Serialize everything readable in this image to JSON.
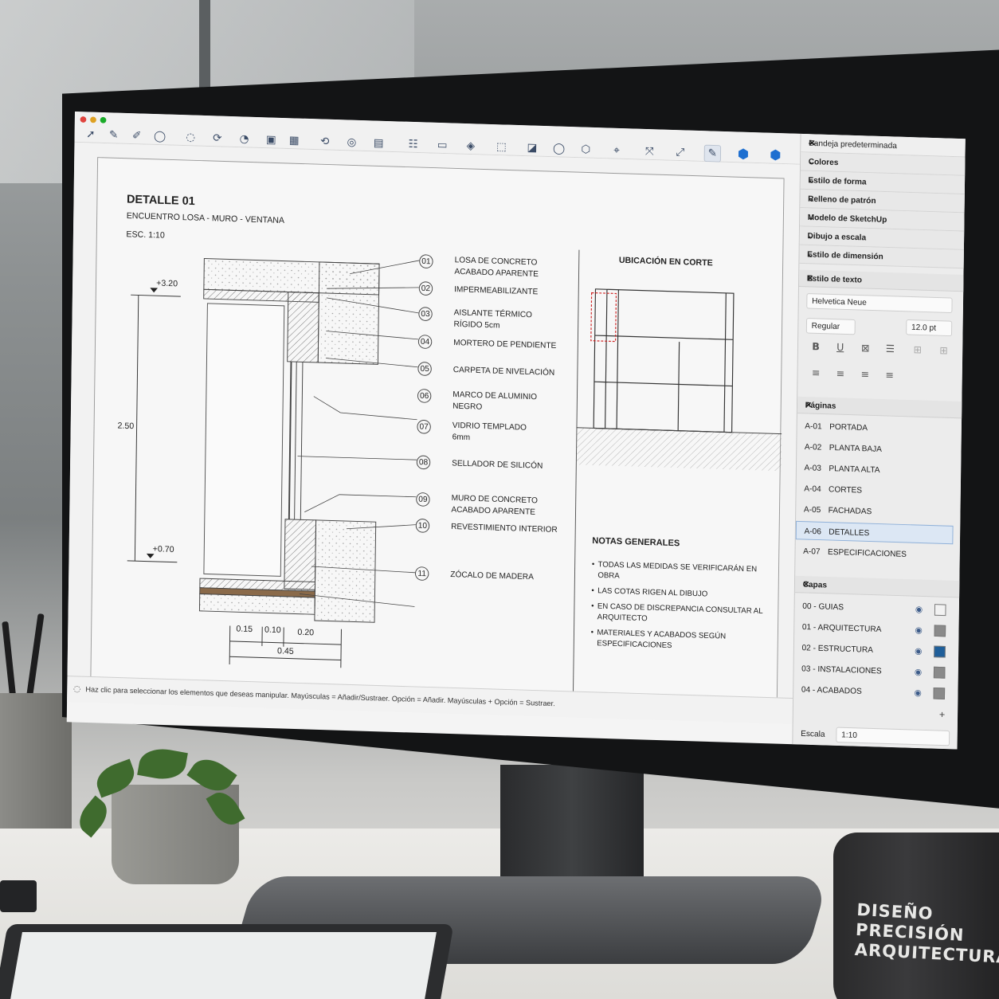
{
  "toolbar": {
    "tools": [
      "select-tool",
      "pencil-tool",
      "line-tool",
      "lasso-tool",
      "shape-tool",
      "arc-tool",
      "rotate-tool",
      "scale-tool",
      "insert-tool",
      "dimension-tool",
      "label-tool",
      "text-tool",
      "table-tool",
      "page-tool",
      "layer-tool",
      "eraser-tool",
      "sample-tool",
      "circle-tool",
      "polygon-tool",
      "offset-tool",
      "split-tool",
      "join-tool",
      "pen-tool",
      "model-tool",
      "sketchup-tool"
    ]
  },
  "header": {
    "title": "DETALLE 01",
    "subtitle": "ENCUENTRO LOSA - MURO - VENTANA",
    "scale": "ESC. 1:10"
  },
  "dimensions": {
    "level_top": "+3.20",
    "level_bottom": "+0.70",
    "height": "2.50",
    "w1": "0.15",
    "w2": "0.10",
    "w3": "0.20",
    "total": "0.45"
  },
  "callouts": [
    {
      "num": "01",
      "label": "LOSA DE CONCRETO\nACABADO APARENTE"
    },
    {
      "num": "02",
      "label": "IMPERMEABILIZANTE"
    },
    {
      "num": "03",
      "label": "AISLANTE TÉRMICO\nRÍGIDO 5cm"
    },
    {
      "num": "04",
      "label": "MORTERO DE PENDIENTE"
    },
    {
      "num": "05",
      "label": "CARPETA DE NIVELACIÓN"
    },
    {
      "num": "06",
      "label": "MARCO DE ALUMINIO\nNEGRO"
    },
    {
      "num": "07",
      "label": "VIDRIO TEMPLADO\n6mm"
    },
    {
      "num": "08",
      "label": "SELLADOR DE SILICÓN"
    },
    {
      "num": "09",
      "label": "MURO DE CONCRETO\nACABADO APARENTE"
    },
    {
      "num": "10",
      "label": "REVESTIMIENTO INTERIOR"
    },
    {
      "num": "11",
      "label": "ZÓCALO DE MADERA"
    }
  ],
  "section": {
    "title": "UBICACIÓN EN CORTE"
  },
  "notes": {
    "title": "NOTAS GENERALES",
    "items": [
      "TODAS LAS MEDIDAS SE VERIFICARÁN EN OBRA",
      "LAS COTAS RIGEN AL DIBUJO",
      "EN CASO DE DISCREPANCIA CONSULTAR AL ARQUITECTO",
      "MATERIALES Y ACABADOS SEGÚN ESPECIFICACIONES"
    ]
  },
  "status": {
    "text": "Haz clic para seleccionar los elementos que deseas manipular. Mayúsculas = Añadir/Sustraer. Opción = Añadir.  Mayúsculas + Opción = Sustraer."
  },
  "tray": {
    "title": "Bandeja predeterminada",
    "panels": [
      "Colores",
      "Estilo de forma",
      "Relleno de patrón",
      "Modelo de SketchUp",
      "Dibujo a escala",
      "Estilo de dimensión"
    ],
    "text_style": {
      "title": "Estilo de texto",
      "font": "Helvetica Neue",
      "weight": "Regular",
      "size": "12.0 pt"
    },
    "pages": {
      "title": "Páginas",
      "items": [
        {
          "code": "A-01",
          "name": "PORTADA"
        },
        {
          "code": "A-02",
          "name": "PLANTA BAJA"
        },
        {
          "code": "A-03",
          "name": "PLANTA ALTA"
        },
        {
          "code": "A-04",
          "name": "CORTES"
        },
        {
          "code": "A-05",
          "name": "FACHADAS"
        },
        {
          "code": "A-06",
          "name": "DETALLES"
        },
        {
          "code": "A-07",
          "name": "ESPECIFICACIONES"
        }
      ],
      "selected": "A-06"
    },
    "layers": {
      "title": "Capas",
      "items": [
        {
          "name": "00  -  GUIAS",
          "color": "#f2f2f2"
        },
        {
          "name": "01  -  ARQUITECTURA",
          "color": "#8a8a8a"
        },
        {
          "name": "02  -  ESTRUCTURA",
          "color": "#1f5f9a"
        },
        {
          "name": "03  -  INSTALACIONES",
          "color": "#8a8a8a"
        },
        {
          "name": "04  -  ACABADOS",
          "color": "#8a8a8a"
        }
      ]
    },
    "scale_label": "Escala",
    "scale_value": "1:10"
  },
  "mug": {
    "line1": "DISEÑO",
    "line2": "PRECISIÓN",
    "line3": "ARQUITECTURA"
  }
}
